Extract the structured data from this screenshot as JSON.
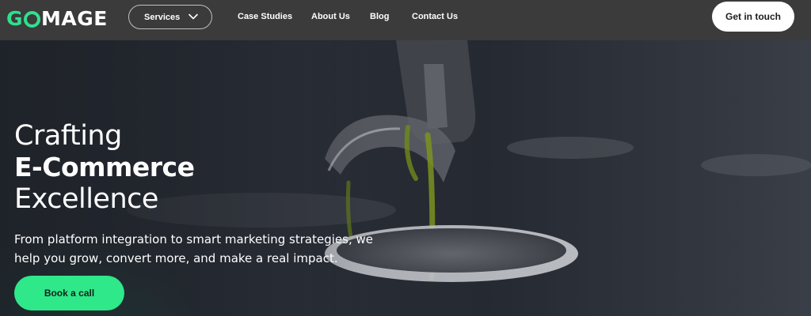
{
  "header": {
    "logo_text": "GOMAGE",
    "services_label": "Services",
    "nav": [
      {
        "label": "Case Studies"
      },
      {
        "label": "About Us"
      },
      {
        "label": "Blog"
      },
      {
        "label": "Contact Us"
      }
    ],
    "cta_label": "Get in touch"
  },
  "hero": {
    "title_line1": "Crafting",
    "title_line2": "E-Commerce",
    "title_line3": "Excellence",
    "description": "From platform integration to smart marketing strategies, we help you grow, convert more, and make a real impact.",
    "button_label": "Book a call"
  },
  "colors": {
    "accent": "#2ee88a",
    "header_bg": "#3b3b3b",
    "text": "#ffffff"
  },
  "icons": {
    "services_chevron": "chevron-down-icon"
  }
}
